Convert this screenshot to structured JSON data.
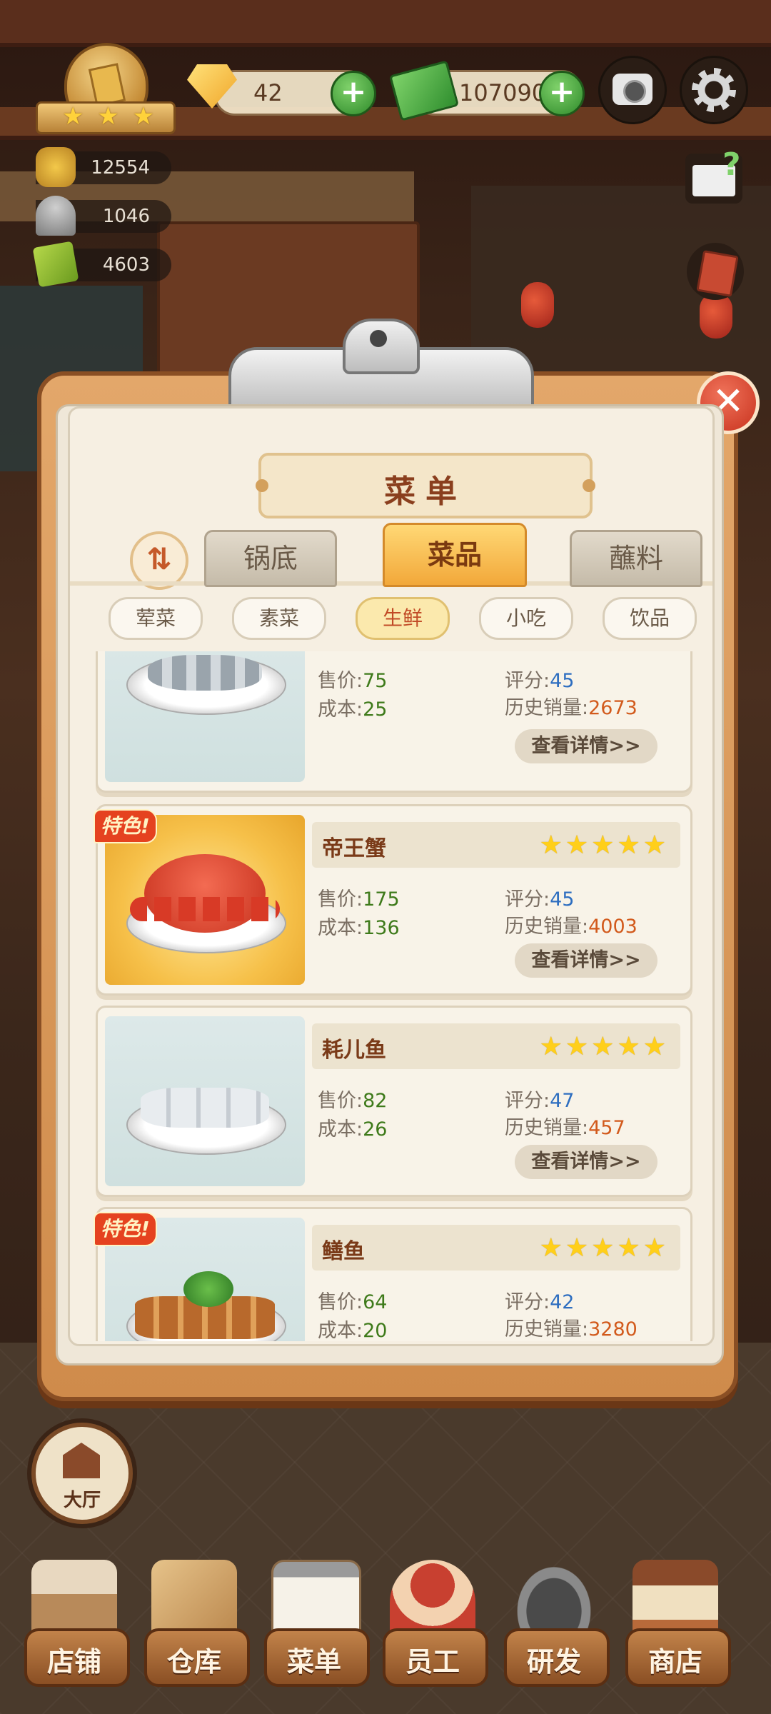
{
  "hud": {
    "gems": "42",
    "cash": "107090",
    "stats": [
      "12554",
      "1046",
      "4603"
    ],
    "badge_stars": "★ ★ ★",
    "help_mark": "?"
  },
  "menu": {
    "title": "菜单",
    "close_symbol": "✕",
    "sort_symbol": "⇅",
    "main_tabs": [
      "锅底",
      "菜品",
      "蘸料"
    ],
    "main_tab_active": "菜品",
    "sub_tabs": [
      "荤菜",
      "素菜",
      "生鲜",
      "小吃",
      "饮品"
    ],
    "sub_tab_active": "生鲜",
    "labels": {
      "price": "售价:",
      "cost": "成本:",
      "rating": "评分:",
      "sales": "历史销量:",
      "detail": "查看详情>>",
      "special": "特色!"
    },
    "items": [
      {
        "name": "",
        "price": "75",
        "cost": "25",
        "rating": "45",
        "sales": "2673",
        "stars": "",
        "special": false
      },
      {
        "name": "帝王蟹",
        "price": "175",
        "cost": "136",
        "rating": "45",
        "sales": "4003",
        "stars": "★★★★★",
        "special": true
      },
      {
        "name": "耗儿鱼",
        "price": "82",
        "cost": "26",
        "rating": "47",
        "sales": "457",
        "stars": "★★★★★",
        "special": false
      },
      {
        "name": "鳝鱼",
        "price": "64",
        "cost": "20",
        "rating": "42",
        "sales": "3280",
        "stars": "★★★★★",
        "special": true
      }
    ]
  },
  "hall": {
    "label": "大厅"
  },
  "nav": [
    {
      "label": "店铺",
      "icon": "shop-icon"
    },
    {
      "label": "仓库",
      "icon": "warehouse-icon"
    },
    {
      "label": "菜单",
      "icon": "clipboard-icon"
    },
    {
      "label": "员工",
      "icon": "staff-icon"
    },
    {
      "label": "研发",
      "icon": "wok-icon"
    },
    {
      "label": "商店",
      "icon": "store-icon"
    }
  ],
  "colors": {
    "accent": "#f2a83a",
    "close": "#c8321e",
    "green": "#3e7a1a",
    "blue": "#2e6ec0",
    "orange": "#d25a1c"
  }
}
